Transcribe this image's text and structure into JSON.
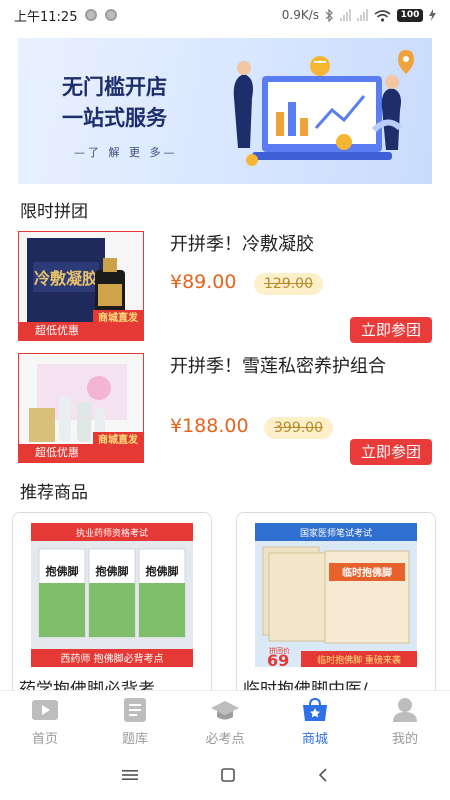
{
  "status_bar": {
    "time": "上午11:25",
    "network_speed": "0.9K/s",
    "battery": "100"
  },
  "banner": {
    "line1": "无门槛开店",
    "line2": "一站式服务",
    "more": "—了 解 更 多—",
    "colors": {
      "bg_start": "#e9f1ff",
      "bg_end": "#c9dcfb",
      "title": "#1e2e6a"
    }
  },
  "sections": {
    "deals_title": "限时拼团",
    "recommend_title": "推荐商品"
  },
  "deals": [
    {
      "title": "开拼季！冷敷凝胶",
      "price": "¥89.00",
      "original_price": "129.00",
      "tag_low": "超低优惠",
      "tag_direct": "商城直发",
      "button": "立即参团",
      "image_text": "冷敷凝胶"
    },
    {
      "title": "开拼季！雪莲私密养护组合",
      "price": "¥188.00",
      "original_price": "399.00",
      "tag_low": "超低优惠",
      "tag_direct": "商城直发",
      "button": "立即参团"
    }
  ],
  "recommend": [
    {
      "title": "药学抱佛脚必背考",
      "image": {
        "header": "执业药师资格考试",
        "book_text": "抱佛脚",
        "footer": "西药师 抱佛脚必背考点"
      }
    },
    {
      "title": "临时抱佛脚中医/",
      "image": {
        "header": "国家医师笔试考试",
        "book_text": "临时抱佛脚",
        "price_label": "拼团价",
        "price": "69",
        "footer": "临时抱佛脚 重磅来袭"
      }
    }
  ],
  "tabbar": [
    {
      "label": "首页",
      "icon": "home-video-icon",
      "active": false
    },
    {
      "label": "题库",
      "icon": "question-bank-icon",
      "active": false
    },
    {
      "label": "必考点",
      "icon": "graduation-cap-icon",
      "active": false
    },
    {
      "label": "商城",
      "icon": "mall-bag-icon",
      "active": true
    },
    {
      "label": "我的",
      "icon": "profile-icon",
      "active": false
    }
  ],
  "colors": {
    "accent": "#2f6fe8",
    "price": "#e5631e",
    "button": "#ea3b3b"
  }
}
